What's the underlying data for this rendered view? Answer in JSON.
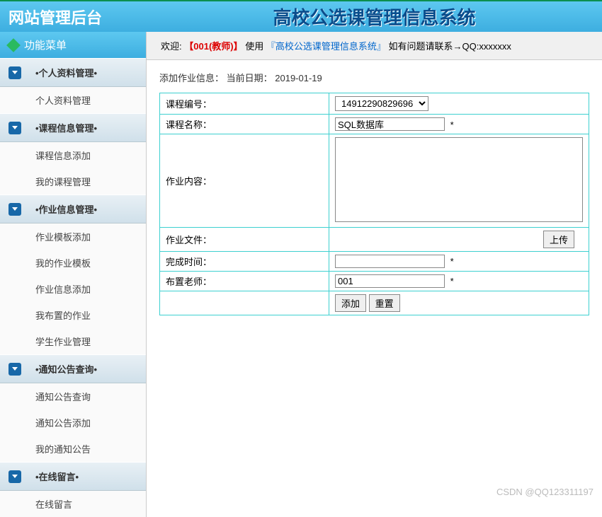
{
  "header": {
    "left_title": "网站管理后台",
    "right_title": "高校公选课管理信息系统"
  },
  "sidebar": {
    "menu_title": "功能菜单",
    "sections": [
      {
        "label": "•个人资料管理•",
        "items": [
          "个人资料管理"
        ]
      },
      {
        "label": "•课程信息管理•",
        "items": [
          "课程信息添加",
          "我的课程管理"
        ]
      },
      {
        "label": "•作业信息管理•",
        "items": [
          "作业模板添加",
          "我的作业模板",
          "作业信息添加",
          "我布置的作业",
          "学生作业管理"
        ]
      },
      {
        "label": "•通知公告查询•",
        "items": [
          "通知公告查询",
          "通知公告添加",
          "我的通知公告"
        ]
      },
      {
        "label": "•在线留言•",
        "items": [
          "在线留言"
        ]
      }
    ]
  },
  "welcome": {
    "prefix": "欢迎:",
    "user": "【001(教师)】",
    "mid": "使用",
    "system": "『高校公选课管理信息系统』",
    "suffix": "如有问题请联系→QQ:xxxxxxx"
  },
  "info": {
    "label": "添加作业信息： 当前日期：",
    "date": "2019-01-19"
  },
  "form": {
    "course_no_label": "课程编号：",
    "course_no_value": "14912290829696",
    "course_name_label": "课程名称：",
    "course_name_value": "SQL数据库",
    "content_label": "作业内容：",
    "file_label": "作业文件：",
    "upload_btn": "上传",
    "time_label": "完成时间：",
    "time_value": "",
    "teacher_label": "布置老师：",
    "teacher_value": "001",
    "add_btn": "添加",
    "reset_btn": "重置",
    "star": "*"
  },
  "watermark": "CSDN @QQ123311197"
}
